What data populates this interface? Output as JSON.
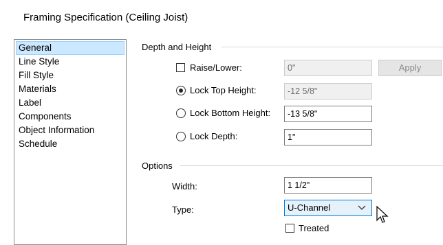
{
  "window": {
    "title": "Framing Specification (Ceiling Joist)"
  },
  "sidebar": {
    "items": [
      {
        "label": "General",
        "selected": true
      },
      {
        "label": "Line Style"
      },
      {
        "label": "Fill Style"
      },
      {
        "label": "Materials"
      },
      {
        "label": "Label"
      },
      {
        "label": "Components"
      },
      {
        "label": "Object Information"
      },
      {
        "label": "Schedule"
      }
    ]
  },
  "depth_height": {
    "header": "Depth and Height",
    "raise_lower": {
      "label": "Raise/Lower:",
      "checked": false,
      "value": "0\"",
      "apply_label": "Apply"
    },
    "lock_top": {
      "label": "Lock Top Height:",
      "selected": true,
      "value": "-12 5/8\""
    },
    "lock_bottom": {
      "label": "Lock Bottom Height:",
      "selected": false,
      "value": "-13 5/8\""
    },
    "lock_depth": {
      "label": "Lock Depth:",
      "selected": false,
      "value": "1\""
    }
  },
  "options": {
    "header": "Options",
    "width": {
      "label": "Width:",
      "value": "1 1/2\""
    },
    "type": {
      "label": "Type:",
      "value": "U-Channel"
    },
    "treated": {
      "label": "Treated",
      "checked": false
    }
  },
  "icons": {
    "dropdown": "chevron-down-icon",
    "cursor": "mouse-pointer-icon"
  },
  "colors": {
    "selection": "#cce8ff",
    "focus_border": "#0078d7"
  }
}
